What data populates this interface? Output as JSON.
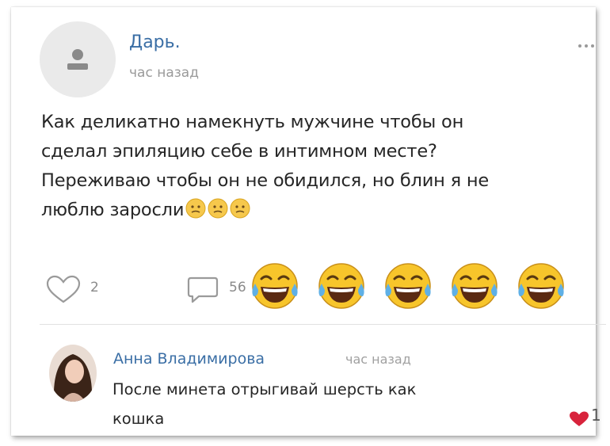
{
  "post": {
    "author": "Дарь.",
    "time": "час назад",
    "text_lines": [
      "Как деликатно намекнуть мужчине чтобы он",
      "сделал эпиляцию себе в интимном месте?",
      "Переживаю чтобы он не обидился, но блин я не",
      "люблю заросли"
    ],
    "inline_emoji": [
      "confused-face-emoji",
      "confused-face-emoji",
      "confused-face-emoji"
    ],
    "likes": "2",
    "comments": "56",
    "reactions": [
      "tears-of-joy-emoji",
      "tears-of-joy-emoji",
      "tears-of-joy-emoji",
      "tears-of-joy-emoji",
      "tears-of-joy-emoji"
    ]
  },
  "comment": {
    "author": "Анна Владимирова",
    "time": "час назад",
    "text_lines": [
      "После минета отрыгивай шерсть как",
      "кошка"
    ],
    "likes": "1"
  },
  "colors": {
    "link": "#3a6ea5",
    "muted": "#9a9a9a",
    "heart": "#d8233c",
    "emoji": "#f7c52b"
  }
}
